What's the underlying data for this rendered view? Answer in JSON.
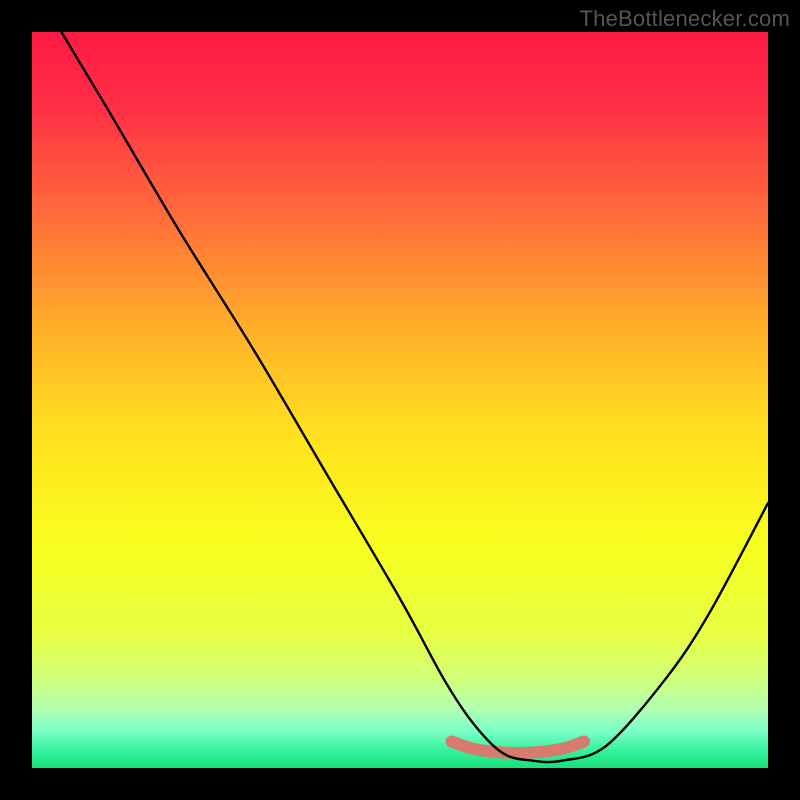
{
  "attribution": "TheBottlenecker.com",
  "chart_data": {
    "type": "line",
    "title": "",
    "xlabel": "",
    "ylabel": "",
    "xlim": [
      0,
      100
    ],
    "ylim": [
      0,
      100
    ],
    "series": [
      {
        "name": "bottleneck-curve",
        "x": [
          4,
          10,
          20,
          30,
          40,
          50,
          56,
          60,
          64,
          68,
          72,
          78,
          86,
          92,
          100
        ],
        "values": [
          100,
          90,
          73,
          57,
          40,
          23,
          12,
          6,
          2,
          1,
          1,
          3,
          12,
          21,
          36
        ]
      }
    ],
    "overlay": {
      "name": "optimal-highlight",
      "x": [
        57,
        60,
        64,
        68,
        72,
        75
      ],
      "values": [
        3.6,
        2.6,
        2.1,
        2.1,
        2.6,
        3.6
      ],
      "color": "#d97a6f",
      "stroke_width": 12
    },
    "gradient_stops": [
      {
        "offset": 0.0,
        "color": "#ff1a44"
      },
      {
        "offset": 0.1,
        "color": "#ff2e46"
      },
      {
        "offset": 0.25,
        "color": "#ff6d3a"
      },
      {
        "offset": 0.4,
        "color": "#ffae2a"
      },
      {
        "offset": 0.55,
        "color": "#ffe21e"
      },
      {
        "offset": 0.7,
        "color": "#f6ff1e"
      },
      {
        "offset": 0.82,
        "color": "#e7ff45"
      },
      {
        "offset": 0.88,
        "color": "#d0ff7a"
      },
      {
        "offset": 0.92,
        "color": "#b0ffb0"
      },
      {
        "offset": 0.95,
        "color": "#7affc8"
      },
      {
        "offset": 0.975,
        "color": "#37f29d"
      },
      {
        "offset": 1.0,
        "color": "#18e07a"
      }
    ]
  }
}
